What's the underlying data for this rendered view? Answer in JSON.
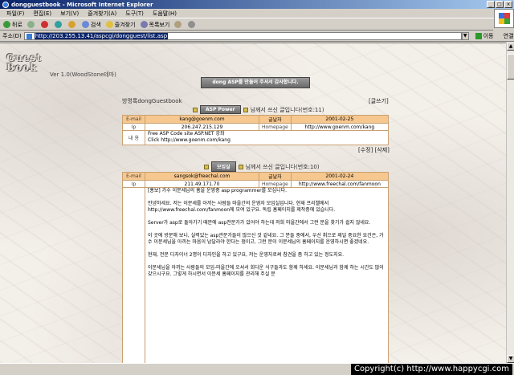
{
  "window": {
    "title": "dongguestbook - Microsoft Internet Explorer"
  },
  "menu": [
    "파일(F)",
    "편집(E)",
    "보기(V)",
    "즐겨찾기(A)",
    "도구(T)",
    "도움말(H)"
  ],
  "toolbar": {
    "back": "뒤로",
    "search": "검색",
    "favorites": "즐겨찾기",
    "history": "목록보기"
  },
  "address": {
    "label": "주소(D)",
    "url": "http://203.255.13.41/aspcgi/dongguest/list.asp",
    "go": "이동",
    "links": "연결"
  },
  "page": {
    "logo": "Guest Book",
    "version": "Ver 1.0(WoodStone테마)",
    "banner": "dong ASP를 만들어 주셔서 감사합니다.",
    "list_title": "방명록dongGuestbook",
    "write_link": "[글쓰기]",
    "labels": {
      "email": "E-mail",
      "date": "글날자",
      "ip": "Ip",
      "homepage": "Homepage",
      "content": "내  용"
    },
    "posts": [
      {
        "name": "ASP Power",
        "head_text": "님께서 쓰신 글입니다(번호:11)",
        "email": "kang@goenm.com",
        "date": "2001-02-25",
        "ip": "206.247.215.129",
        "homepage": "http://www.goenm.com/kang",
        "content": [
          "Free ASP Code site ASP.NET 강좌",
          "Click http://www.goenm.com/kang"
        ],
        "actions": "[수정] [삭제]"
      },
      {
        "name": "모임실",
        "head_text": "님께서 쓰신 글입니다(번호:10)",
        "email": "sangsok@freechal.com",
        "date": "2001-02-24",
        "ip": "211.49.171.70",
        "homepage": "http://www.freechal.com/fanmoon",
        "content": [
          "[홍보] 가수 이문세님의 홈을 운영중 asp programmer를 모십니다.",
          "안녕하세요. 저는 이문세를 아끼는 사람들 마을간의 운영자 모임실입니다. 현재 프리챌에서 http://www.freechal.com/fanmoon에 모여 있구요. 독립 홈페이지를 제작중에 있습니다.",
          "Server가 asp로 돌아가기 때문에 asp전문가가 있어야 하는데 저희 마을간에서 그런 분을 찾기가 쉽지 않네요.",
          "이 곳에 방문해 보니, 실력있는 asp관문가들이 많으신 것 같네요. 그 분들 중에서, 우선 취으로 제일 중요한 요건은, 가수 이문세님을 아끼는 마음이 남달라야 한다는 점이고, 그런 분이 이문세님의 홈페이지를 운영하시면 좋겠네요.",
          "현재, 전문 디자이너 2명이 디자인을 하고 있구요, 저는 운영자로써 참견을 좀 하고 있는 정도지요.",
          "이문세님을 아끼는 사람들의 모임-마을간에 오셔서 회다운 식구들과도 함께 하세요. 이문세님과 함께 하는 시간도 많이 갖으시구요. 그렇게 하시면서 이문세 홈페이지를 관리해 주실 분"
        ]
      }
    ]
  },
  "status": {
    "copyright": "Copyright(c) http://www.happycgi.com"
  }
}
